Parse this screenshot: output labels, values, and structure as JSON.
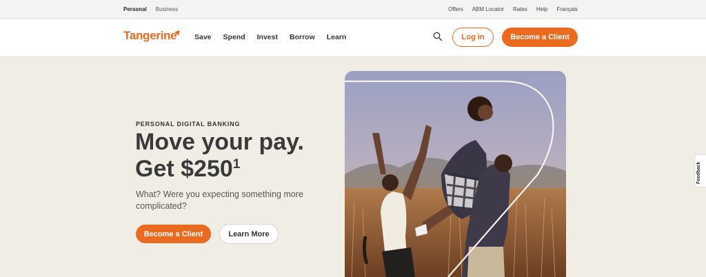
{
  "topbar": {
    "left": [
      "Personal",
      "Business"
    ],
    "right": [
      "Offers",
      "ABM Locator",
      "Rates",
      "Help",
      "Français"
    ]
  },
  "nav": {
    "logo": "Tangerine",
    "items": [
      "Save",
      "Spend",
      "Invest",
      "Borrow",
      "Learn"
    ],
    "login": "Log in",
    "become": "Become a Client"
  },
  "hero": {
    "eyebrow": "PERSONAL DIGITAL BANKING",
    "headline_line1": "Move your pay.",
    "headline_line2": "Get $250",
    "headline_sup": "1",
    "subtext": "What? Were you expecting something more complicated?",
    "cta_primary": "Become a Client",
    "cta_secondary": "Learn More"
  },
  "feedback": "Feedback",
  "colors": {
    "brand_orange": "#ea6a1f",
    "hero_bg": "#f0eee4"
  }
}
